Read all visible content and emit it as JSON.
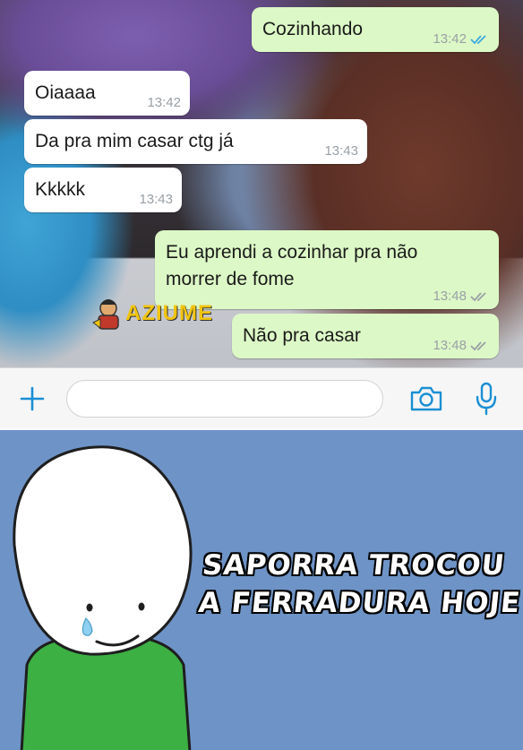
{
  "chat": {
    "messages": [
      {
        "direction": "out",
        "text": "Cozinhando",
        "time": "13:42",
        "status": "read"
      },
      {
        "direction": "in",
        "text": "Oiaaaa",
        "time": "13:42"
      },
      {
        "direction": "in",
        "text": "Da pra mim casar ctg já",
        "time": "13:43"
      },
      {
        "direction": "in",
        "text": "Kkkkk",
        "time": "13:43"
      },
      {
        "direction": "out",
        "text_line1": "Eu aprendi a cozinhar pra não",
        "text_line2": "morrer de fome",
        "time": "13:48",
        "status": "delivered"
      },
      {
        "direction": "out",
        "text": "Não pra casar",
        "time": "13:48",
        "status": "delivered"
      }
    ],
    "watermark": "AZIUME"
  },
  "input_bar": {
    "icons": [
      "plus-icon",
      "camera-icon",
      "microphone-icon"
    ],
    "accent_color": "#1a8fd3"
  },
  "meme": {
    "line1": "SAPORRA TROCOU",
    "line2": "A FERRADURA HOJE",
    "background_color": "#6e93c6",
    "shirt_color": "#3cb043"
  }
}
